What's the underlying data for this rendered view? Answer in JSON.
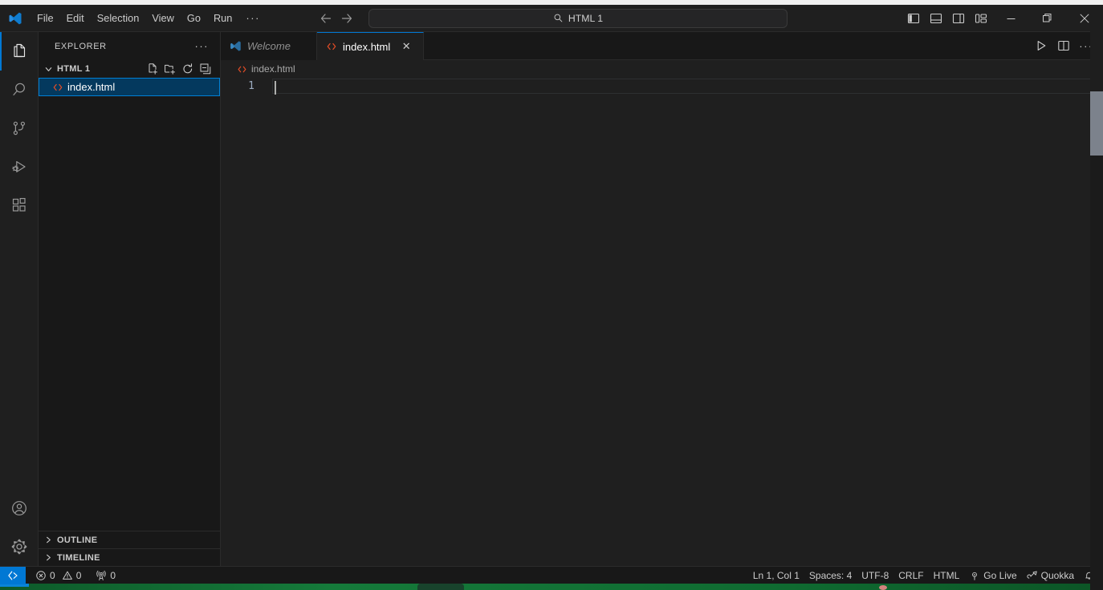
{
  "app": {
    "logo_icon": "vscode-logo-icon",
    "command_center_text": "HTML 1",
    "command_center_icon": "search-icon"
  },
  "menu": {
    "items": [
      {
        "label": "File"
      },
      {
        "label": "Edit"
      },
      {
        "label": "Selection"
      },
      {
        "label": "View"
      },
      {
        "label": "Go"
      },
      {
        "label": "Run"
      }
    ],
    "more_label": "···"
  },
  "nav": {
    "back_icon": "arrow-left-icon",
    "forward_icon": "arrow-right-icon"
  },
  "title_actions": {
    "layout_buttons": [
      {
        "name": "toggle-primary-sidebar",
        "icon": "layout-sidebar-left-icon"
      },
      {
        "name": "toggle-panel",
        "icon": "layout-panel-icon"
      },
      {
        "name": "toggle-secondary-sidebar",
        "icon": "layout-sidebar-right-icon"
      },
      {
        "name": "customize-layout",
        "icon": "layout-customize-icon"
      }
    ],
    "window_buttons": [
      {
        "name": "minimize",
        "icon": "minimize-icon",
        "glyph": "─"
      },
      {
        "name": "restore",
        "icon": "restore-icon",
        "glyph": "❐"
      },
      {
        "name": "close",
        "icon": "close-icon",
        "glyph": "✕"
      }
    ]
  },
  "activity_bar": {
    "items": [
      {
        "label": "Explorer",
        "icon": "files-icon",
        "active": true
      },
      {
        "label": "Search",
        "icon": "search-icon",
        "active": false
      },
      {
        "label": "Source Control",
        "icon": "source-control-icon",
        "active": false
      },
      {
        "label": "Run and Debug",
        "icon": "run-debug-icon",
        "active": false
      },
      {
        "label": "Extensions",
        "icon": "extensions-icon",
        "active": false
      }
    ],
    "bottom_items": [
      {
        "label": "Accounts",
        "icon": "account-icon"
      },
      {
        "label": "Manage",
        "icon": "gear-icon"
      }
    ]
  },
  "sidebar": {
    "title": "EXPLORER",
    "more_label": "···",
    "folder_section": {
      "label": "HTML 1",
      "expanded": true,
      "actions": [
        {
          "label": "New File...",
          "icon": "new-file-icon"
        },
        {
          "label": "New Folder...",
          "icon": "new-folder-icon"
        },
        {
          "label": "Refresh Explorer",
          "icon": "refresh-icon"
        },
        {
          "label": "Collapse Folders in Explorer",
          "icon": "collapse-all-icon"
        }
      ]
    },
    "files": [
      {
        "label": "index.html",
        "icon": "html-file-icon",
        "selected": true
      }
    ],
    "bottom_sections": [
      {
        "label": "OUTLINE",
        "expanded": false
      },
      {
        "label": "TIMELINE",
        "expanded": false
      }
    ]
  },
  "tabs": [
    {
      "label": "Welcome",
      "icon": "vscode-logo-icon",
      "active": false,
      "italic": true,
      "closable": false
    },
    {
      "label": "index.html",
      "icon": "html-file-icon",
      "active": true,
      "italic": false,
      "closable": true,
      "close_glyph": "✕"
    }
  ],
  "editor_actions": [
    {
      "label": "Run or Debug...",
      "icon": "run-play-icon"
    },
    {
      "label": "Split Editor Right",
      "icon": "split-editor-icon"
    },
    {
      "label": "More Actions...",
      "icon": "more-actions-icon",
      "glyph": "···"
    }
  ],
  "breadcrumbs": {
    "items": [
      {
        "label": "index.html",
        "icon": "html-file-icon"
      }
    ]
  },
  "editor": {
    "line_numbers": [
      "1"
    ],
    "lines": [
      ""
    ],
    "cursor_line": 1
  },
  "status_bar": {
    "remote": {
      "label": "",
      "icon": "remote-indicator-icon"
    },
    "left_items": [
      {
        "name": "problems-errors",
        "icon": "error-circle-icon",
        "value": "0"
      },
      {
        "name": "problems-warnings",
        "icon": "warning-triangle-icon",
        "value": "0"
      },
      {
        "name": "ports",
        "icon": "radio-tower-icon",
        "value": "0"
      }
    ],
    "right_items": [
      {
        "name": "editor-position",
        "label": "Ln 1, Col 1"
      },
      {
        "name": "editor-indentation",
        "label": "Spaces: 4"
      },
      {
        "name": "editor-encoding",
        "label": "UTF-8"
      },
      {
        "name": "editor-eol",
        "label": "CRLF"
      },
      {
        "name": "editor-language",
        "label": "HTML"
      },
      {
        "name": "go-live",
        "label": "Go Live",
        "icon": "broadcast-icon"
      },
      {
        "name": "quokka",
        "label": "Quokka",
        "icon": "quokka-icon"
      },
      {
        "name": "notifications",
        "label": "",
        "icon": "bell-icon"
      }
    ]
  },
  "colors": {
    "accent": "#0078d4",
    "selection_bg": "#04395e",
    "selection_border": "#007fd4",
    "html_icon": "#e44d26",
    "titlebar_bg": "#1f1f1f",
    "sidebar_bg": "#181818",
    "editor_bg": "#1f1f1f",
    "statusbar_bg": "#181818",
    "text": "#cccccc"
  }
}
